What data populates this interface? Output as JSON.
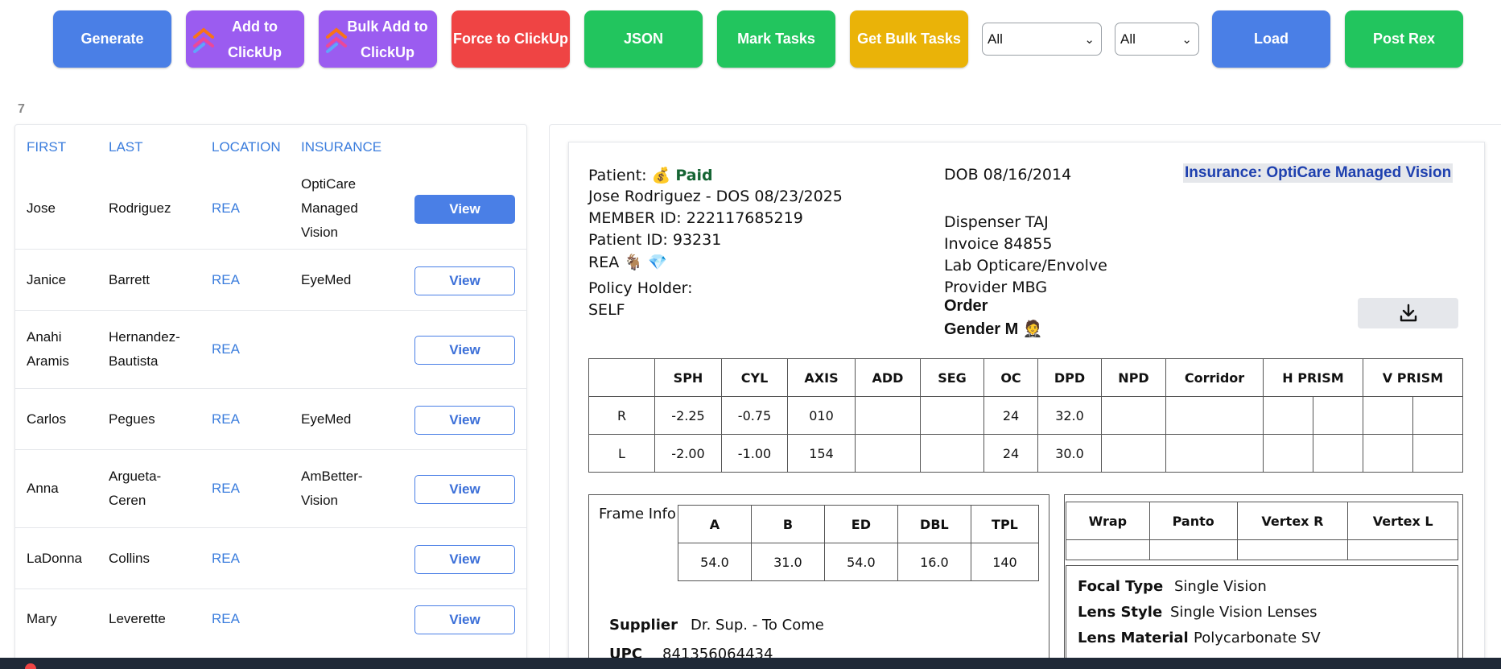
{
  "toolbar": {
    "generate": "Generate",
    "add_clickup_1": "Add to",
    "add_clickup_2": "ClickUp",
    "bulk_add_1": "Bulk Add to",
    "bulk_add_2": "ClickUp",
    "force": "Force to ClickUp",
    "json": "JSON",
    "mark_tasks": "Mark Tasks",
    "get_bulk": "Get Bulk Tasks",
    "filter1": "All",
    "filter2": "All",
    "load": "Load",
    "post_rex": "Post Rex"
  },
  "count": "7",
  "list": {
    "headers": {
      "first": "FIRST",
      "last": "LAST",
      "location": "LOCATION",
      "insurance": "INSURANCE"
    },
    "view_label": "View",
    "rows": [
      {
        "first": "Jose",
        "last": "Rodriguez",
        "location": "REA",
        "ins1": "OptiCare",
        "ins2": "Managed",
        "ins3": "Vision"
      },
      {
        "first": "Janice",
        "last": "Barrett",
        "location": "REA",
        "ins1": "EyeMed"
      },
      {
        "first1": "Anahi",
        "first2": "Aramis",
        "last1": "Hernandez-",
        "last2": "Bautista",
        "location": "REA"
      },
      {
        "first": "Carlos",
        "last": "Pegues",
        "location": "REA",
        "ins1": "EyeMed"
      },
      {
        "first": "Anna",
        "last1": "Argueta-",
        "last2": "Ceren",
        "location": "REA",
        "ins1": "AmBetter-",
        "ins2": "Vision"
      },
      {
        "first": "LaDonna",
        "last": "Collins",
        "location": "REA"
      },
      {
        "first": "Mary",
        "last": "Leverette",
        "location": "REA"
      }
    ]
  },
  "detail": {
    "patient_label": "Patient: 💰",
    "paid": "Paid",
    "name_dos": "Jose Rodriguez - DOS 08/23/2025",
    "member_id": "MEMBER ID: 222117685219",
    "patient_id": "Patient ID: 93231",
    "rea": "REA 🐐 💎",
    "policy_holder_label": "Policy Holder:",
    "policy_holder": "SELF",
    "dob": "DOB  08/16/2014",
    "insurance": "Insurance: OptiCare Managed Vision",
    "dispenser": "Dispenser TAJ",
    "invoice": "Invoice 84855",
    "lab": "Lab Opticare/Envolve",
    "provider": "Provider MBG",
    "order": "Order",
    "gender": "Gender  M 🤵",
    "rx": {
      "headers": [
        "",
        "SPH",
        "CYL",
        "AXIS",
        "ADD",
        "SEG",
        "OC",
        "DPD",
        "NPD",
        "Corridor",
        "H PRISM",
        "V PRISM"
      ],
      "r": [
        "R",
        "-2.25",
        "-0.75",
        "010",
        "",
        "",
        "24",
        "32.0",
        "",
        ""
      ],
      "l": [
        "L",
        "-2.00",
        "-1.00",
        "154",
        "",
        "",
        "24",
        "30.0",
        "",
        ""
      ]
    },
    "frame_info": "Frame Info",
    "frame": {
      "headers": [
        "A",
        "B",
        "ED",
        "DBL",
        "TPL"
      ],
      "values": [
        "54.0",
        "31.0",
        "54.0",
        "16.0",
        "140"
      ]
    },
    "wrap_headers": [
      "Wrap",
      "Panto",
      "Vertex R",
      "Vertex L"
    ],
    "focal_type_label": "Focal Type",
    "focal_type": "Single Vision",
    "lens_style_label": "Lens Style",
    "lens_style": "Single Vision Lenses",
    "lens_material_label": "Lens Material",
    "lens_material": "Polycarbonate SV",
    "supplier_label": "Supplier",
    "supplier": "Dr. Sup. - To Come",
    "upc_label": "UPC",
    "upc": "841356064434"
  }
}
